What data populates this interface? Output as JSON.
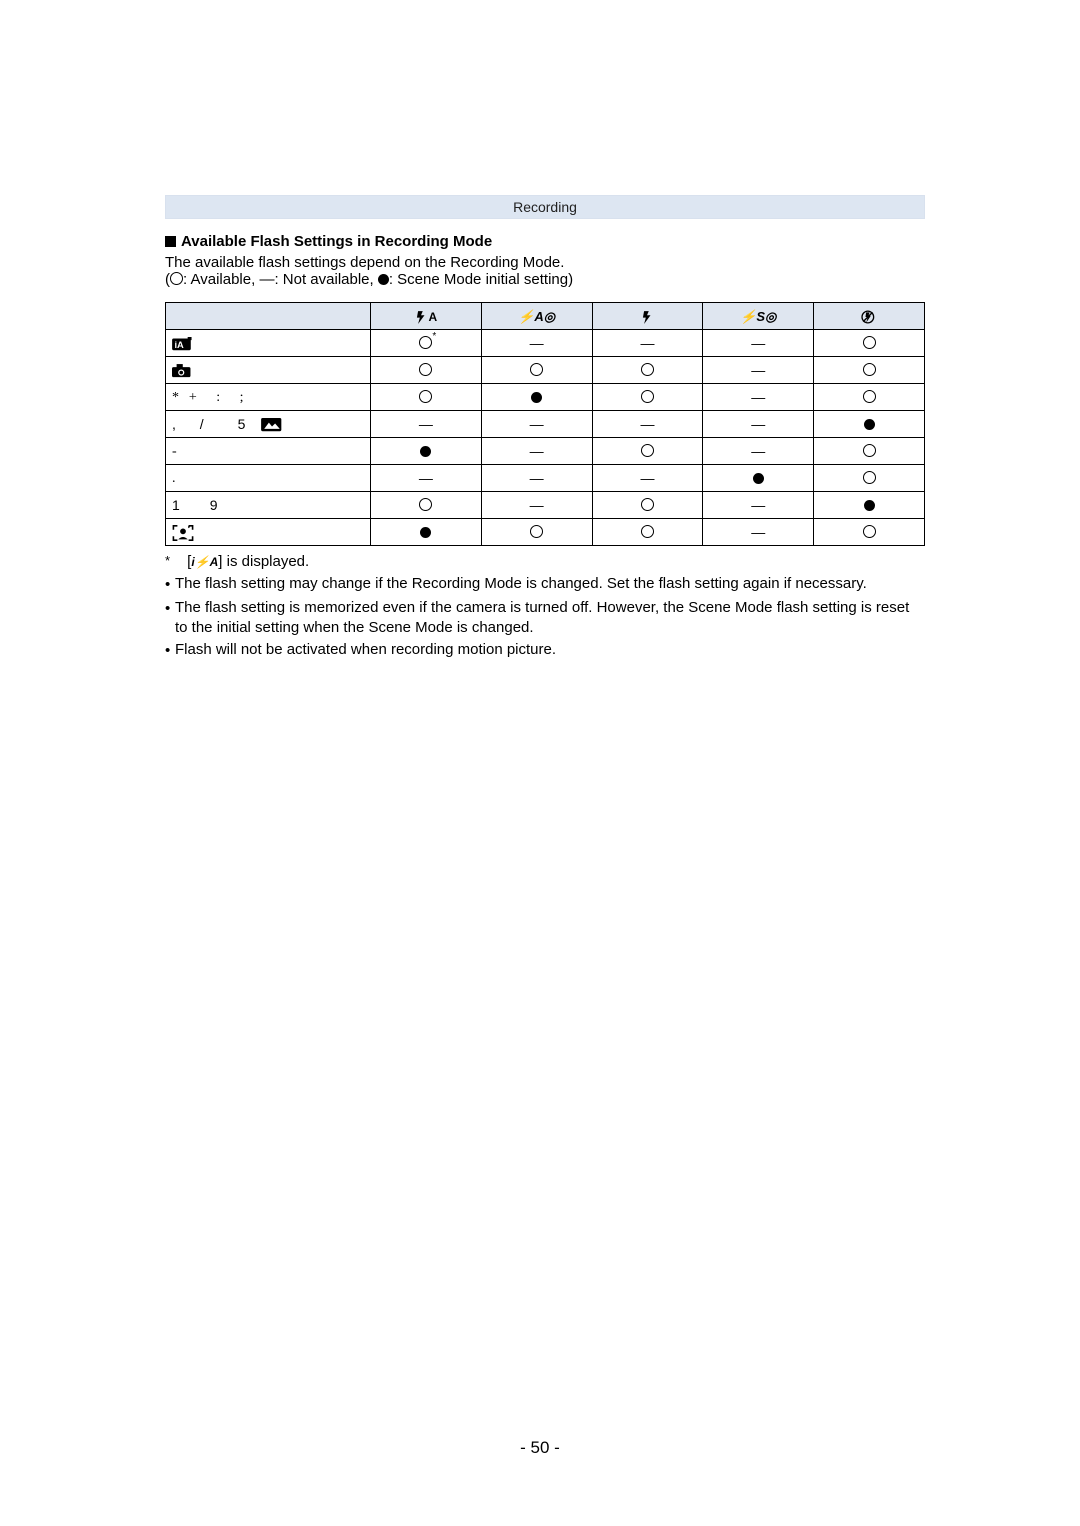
{
  "breadcrumb": "Recording",
  "section_heading": "Available Flash Settings in Recording Mode",
  "intro_line": "The available flash settings depend on the Recording Mode.",
  "legend": {
    "available": ": Available, ",
    "dash_text": "—: Not available, ",
    "initial": ": Scene Mode initial setting)"
  },
  "legend_open_paren": "(",
  "columns": {
    "c1": "",
    "c2": "",
    "c3": "",
    "c4": "",
    "c5": ""
  },
  "rows": [
    {
      "label": "iA",
      "cells": [
        "avail_sup",
        "dash",
        "dash",
        "dash",
        "avail"
      ]
    },
    {
      "label": "camera",
      "cells": [
        "avail",
        "avail",
        "avail",
        "dash",
        "avail"
      ]
    },
    {
      "label": "star_syms",
      "cells": [
        "avail",
        "filled",
        "avail",
        "dash",
        "avail"
      ]
    },
    {
      "label": "group_a",
      "cells": [
        "dash",
        "dash",
        "dash",
        "dash",
        "filled"
      ]
    },
    {
      "label": "hyphen",
      "cells": [
        "filled",
        "dash",
        "avail",
        "dash",
        "avail"
      ]
    },
    {
      "label": "dot",
      "cells": [
        "dash",
        "dash",
        "dash",
        "filled",
        "avail"
      ]
    },
    {
      "label": "one_nine",
      "cells": [
        "avail",
        "dash",
        "avail",
        "dash",
        "filled"
      ]
    },
    {
      "label": "face_detect",
      "cells": [
        "filled",
        "avail",
        "avail",
        "dash",
        "avail"
      ]
    }
  ],
  "footnote_star": "[      ] is displayed.",
  "footnote_flash_icon_text": "i⚡A",
  "bullets": [
    "The flash setting may change if the Recording Mode is changed. Set the flash setting again if necessary.",
    "The flash setting is memorized even if the camera is turned off. However, the Scene Mode flash setting is reset to the initial setting when the Scene Mode is changed.",
    "Flash will not be activated when recording motion picture."
  ],
  "row_label_text": {
    "star_syms_extra": "+ : ;",
    "group_a_left": ", /",
    "group_a_num": "5",
    "one_nine_a": "1",
    "one_nine_b": "9"
  },
  "header_flash_text": {
    "c2": "⚡A◎",
    "c4": "⚡S◎"
  },
  "page_number": "- 50 -"
}
